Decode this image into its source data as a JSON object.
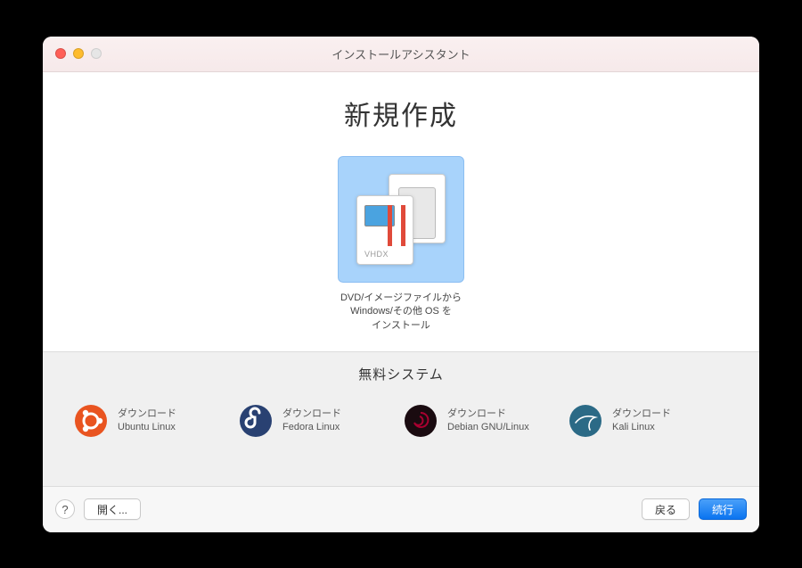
{
  "window": {
    "title": "インストールアシスタント"
  },
  "create": {
    "heading": "新規作成",
    "option": {
      "icon_label": "VHDX",
      "caption_line1": "DVD/イメージファイルから",
      "caption_line2": "Windows/その他 OS を",
      "caption_line3": "インストール"
    }
  },
  "free": {
    "heading": "無料システム",
    "download_label": "ダウンロード",
    "items": [
      {
        "name": "Ubuntu Linux",
        "color": "#e95420",
        "icon": "ubuntu"
      },
      {
        "name": "Fedora Linux",
        "color": "#294172",
        "icon": "fedora"
      },
      {
        "name": "Debian GNU/Linux",
        "color": "#a80030",
        "icon": "debian"
      },
      {
        "name": "Kali Linux",
        "color": "#2b6a86",
        "icon": "kali"
      }
    ]
  },
  "footer": {
    "help": "?",
    "open": "開く...",
    "back": "戻る",
    "continue": "続行"
  }
}
